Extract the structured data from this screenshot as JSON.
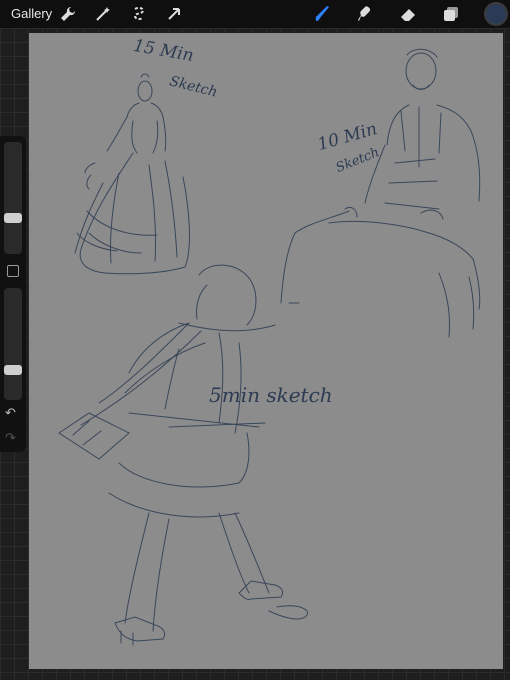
{
  "topbar": {
    "gallery_label": "Gallery",
    "left_tools": [
      "wrench-icon",
      "magic-wand-icon",
      "selection-icon",
      "transform-arrow-icon"
    ],
    "right_tools": [
      "brush-icon",
      "smudge-icon",
      "eraser-icon",
      "layers-icon"
    ],
    "active_tool": "brush-icon",
    "active_color": "#2b3a55",
    "accent": "#2d7ff9"
  },
  "sidebar": {
    "brush_size_level": 0.3,
    "opacity_level": 0.25,
    "undo_icon": "undo-icon",
    "redo_icon": "redo-icon"
  },
  "canvas": {
    "background": "#8c8c8c",
    "ink": "#2c3b52",
    "labels": {
      "label_15": "15 Min",
      "label_15_b": "Sketch",
      "label_10": "10 Min",
      "label_10_b": "Sketch",
      "label_5": "5min sketch"
    }
  }
}
